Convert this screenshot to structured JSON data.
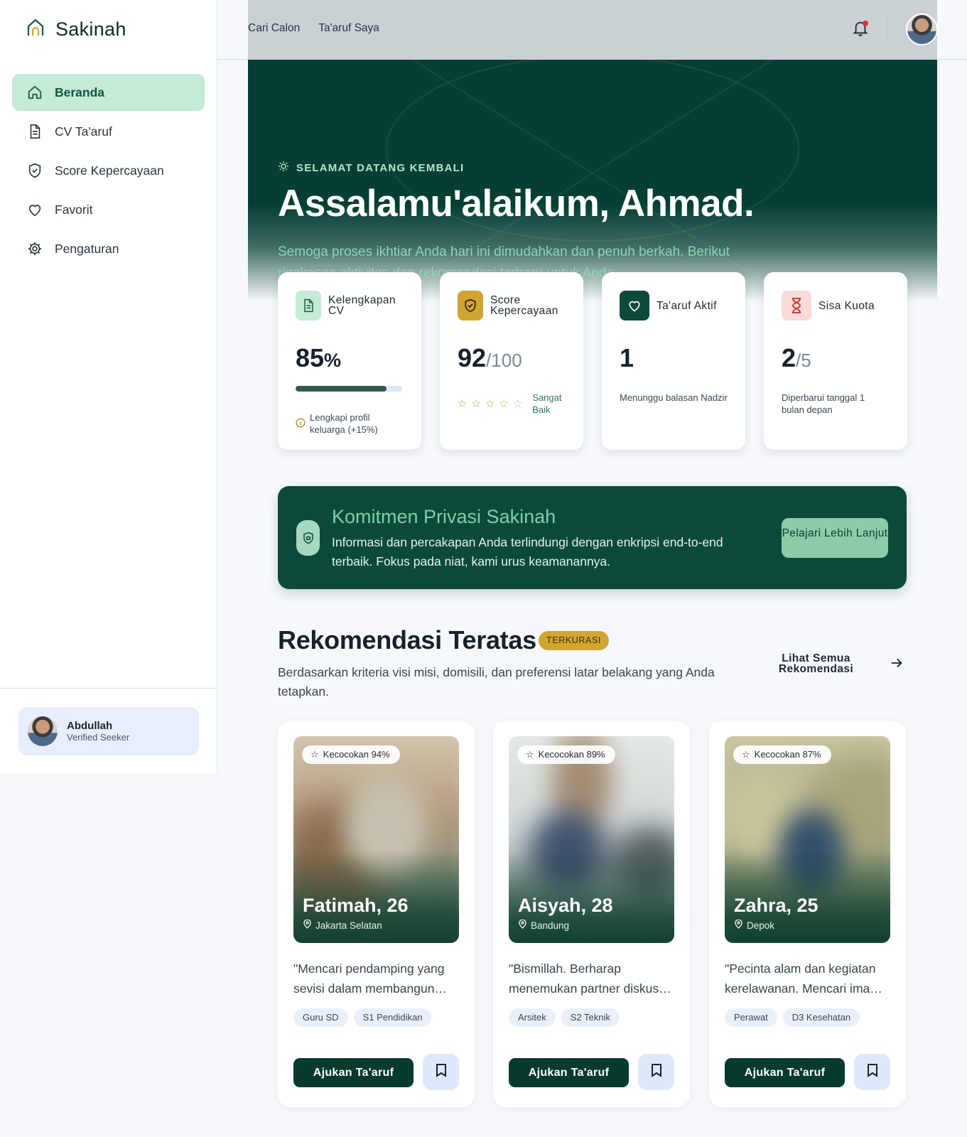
{
  "brand": {
    "name": "Sakinah",
    "icon": "mosque-home-icon"
  },
  "sidebar": {
    "items": [
      {
        "label": "Beranda",
        "icon": "home-icon",
        "active": true
      },
      {
        "label": "CV Ta'aruf",
        "icon": "document-icon"
      },
      {
        "label": "Score Kepercayaan",
        "icon": "shield-check-icon"
      },
      {
        "label": "Favorit",
        "icon": "heart-icon"
      },
      {
        "label": "Pengaturan",
        "icon": "gear-icon"
      }
    ],
    "user": {
      "name": "Abdullah",
      "role": "Verified Seeker"
    }
  },
  "topbar": {
    "links": [
      "Cari Calon",
      "Ta'aruf Saya"
    ],
    "notification_icon": "bell-icon",
    "has_unread": true
  },
  "hero": {
    "kicker": "SELAMAT DATANG KEMBALI",
    "title": "Assalamu'alaikum, Ahmad.",
    "subtitle": "Semoga proses ikhtiar Anda hari ini dimudahkan dan penuh berkah. Berikut ringkasan aktivitas dan rekomendasi terbaru untuk Anda."
  },
  "stats": {
    "cv": {
      "label": "Kelengkapan CV",
      "value": "85",
      "unit": "%",
      "progress": 0.85,
      "note": "Lengkapi profil keluarga (+15%)"
    },
    "trust": {
      "label": "Score Kepercayaan",
      "value": "92",
      "suffix": "/100",
      "stars_filled": 4,
      "stars_total": 5,
      "rating": "Sangat Baik"
    },
    "active": {
      "label": "Ta'aruf Aktif",
      "value": "1",
      "note": "Menunggu balasan Nadzir"
    },
    "quota": {
      "label": "Sisa Kuota",
      "value": "2",
      "suffix": "/5",
      "note": "Diperbarui tanggal 1 bulan depan"
    }
  },
  "privacy": {
    "title": "Komitmen Privasi Sakinah",
    "description": "Informasi dan percakapan Anda terlindungi dengan enkripsi end-to-end terbaik. Fokus pada niat, kami urus keamanannya.",
    "button": "Pelajari Lebih Lanjut"
  },
  "recommendations": {
    "title": "Rekomendasi Teratas",
    "badge": "TERKURASI",
    "description": "Berdasarkan kriteria visi misi, domisili, dan preferensi latar belakang yang Anda tetapkan.",
    "see_all": "Lihat Semua Rekomendasi",
    "cta": "Ajukan Ta'aruf",
    "profiles": [
      {
        "match": "Kecocokan 94%",
        "name": "Fatimah, 26",
        "location": "Jakarta Selatan",
        "quote": "\"Mencari pendamping yang sevisi dalam membangun…",
        "tags": [
          "Guru SD",
          "S1 Pendidikan"
        ]
      },
      {
        "match": "Kecocokan 89%",
        "name": "Aisyah, 28",
        "location": "Bandung",
        "quote": "\"Bismillah. Berharap menemukan partner diskus…",
        "tags": [
          "Arsitek",
          "S2 Teknik"
        ]
      },
      {
        "match": "Kecocokan 87%",
        "name": "Zahra, 25",
        "location": "Depok",
        "quote": "\"Pecinta alam dan kegiatan kerelawanan. Mencari ima…",
        "tags": [
          "Perawat",
          "D3 Kesehatan"
        ]
      }
    ]
  },
  "colors": {
    "primary": "#053f33",
    "accent": "#c4ebd6",
    "gold": "#d1a532"
  }
}
